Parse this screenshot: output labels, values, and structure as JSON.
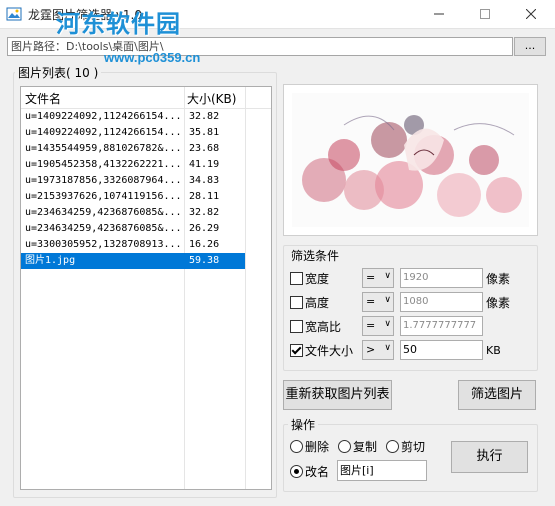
{
  "window": {
    "title": "龙霆图片筛选器 v1.0",
    "watermark": "河东软件园",
    "watermark_url": "www.pc0359.cn",
    "minimize_icon": "minimize-icon",
    "maximize_icon": "maximize-icon",
    "close_icon": "close-icon"
  },
  "path": {
    "label_value": "图片路径：D:\\tools\\桌面\\图片\\",
    "browse_label": "..."
  },
  "list_group": {
    "legend": "图片列表( 10 )",
    "columns": [
      "文件名",
      "大小(KB)"
    ],
    "rows": [
      {
        "name": "u=1409224092,1124266154...",
        "size": "32.82"
      },
      {
        "name": "u=1409224092,1124266154...",
        "size": "35.81"
      },
      {
        "name": "u=1435544959,881026782&...",
        "size": "23.68"
      },
      {
        "name": "u=1905452358,4132262221...",
        "size": "41.19"
      },
      {
        "name": "u=1973187856,3326087964...",
        "size": "34.83"
      },
      {
        "name": "u=2153937626,1074119156...",
        "size": "28.11"
      },
      {
        "name": "u=234634259,4236876085&...",
        "size": "32.82"
      },
      {
        "name": "u=234634259,4236876085&...",
        "size": "26.29"
      },
      {
        "name": "u=3300305952,1328708913...",
        "size": "16.26"
      },
      {
        "name": "图片1.jpg",
        "size": "59.38"
      }
    ]
  },
  "filter": {
    "legend": "筛选条件",
    "rows": [
      {
        "label": "宽度",
        "checked": false,
        "op": "=",
        "value": "1920",
        "unit": "像素"
      },
      {
        "label": "高度",
        "checked": false,
        "op": "=",
        "value": "1080",
        "unit": "像素"
      },
      {
        "label": "宽高比",
        "checked": false,
        "op": "=",
        "value": "1.7777777777",
        "unit": ""
      },
      {
        "label": "文件大小",
        "checked": true,
        "op": ">",
        "value": "50",
        "unit": "KB"
      }
    ]
  },
  "buttons": {
    "refresh": "重新获取图片列表",
    "filter": "筛选图片",
    "execute": "执行"
  },
  "operation": {
    "legend": "操作",
    "options": [
      "删除",
      "复制",
      "剪切",
      "改名"
    ],
    "selected": "改名",
    "rename_value": "图片[i]"
  },
  "colors": {
    "selection": "#0078d7",
    "watermark": "#1e90d6"
  }
}
